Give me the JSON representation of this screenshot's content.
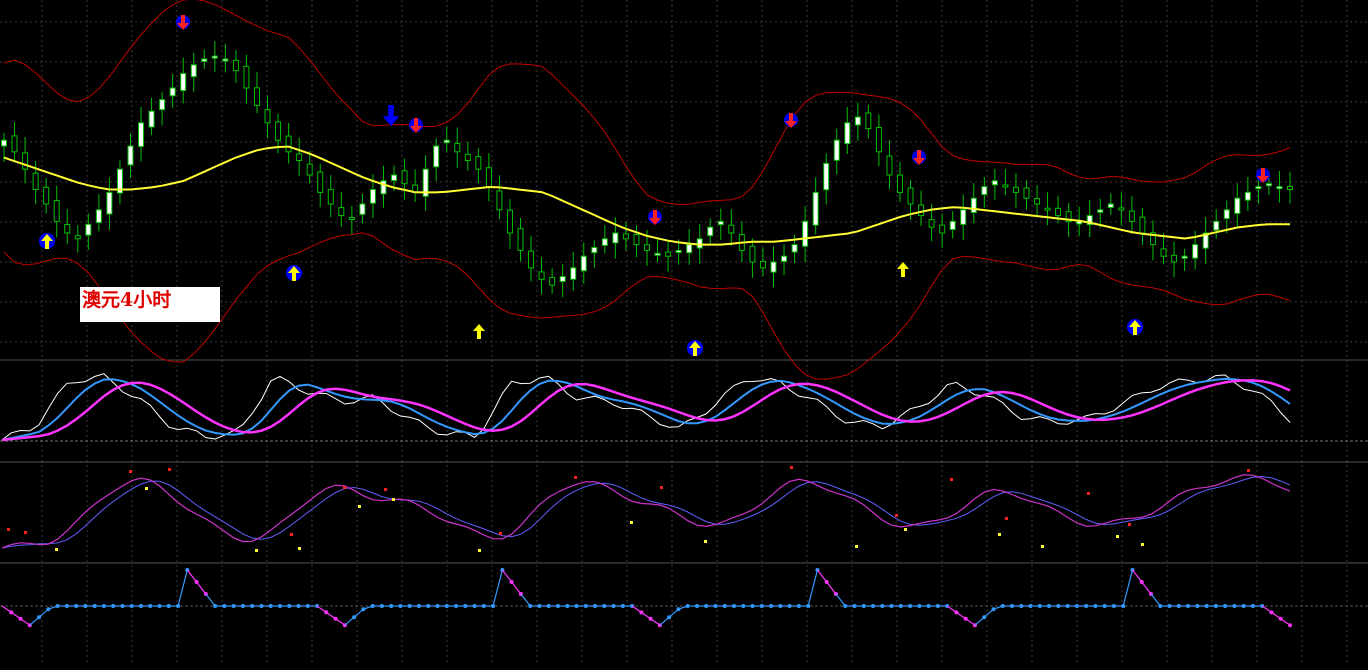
{
  "colors": {
    "background": "#000000",
    "grid": "#3a3a3a",
    "bull_candle": "#ffffff",
    "candle_edge": "#00c000",
    "bollinger": "#c00000",
    "ma": "#ffff33",
    "buy_arrow": "#ffff00",
    "sell_arrow": "#ff2020",
    "big_arrow": "#0000ff",
    "osc1_fast": "#ffffff",
    "osc1_mid": "#3399ff",
    "osc1_slow": "#ff33ff",
    "osc2_main": "#cc33cc",
    "osc2_signal": "#6060ff",
    "osc3_up": "#3399ff",
    "osc3_down": "#ff33ff"
  },
  "chart_label": "澳元4小时",
  "price_panel": {
    "type": "candlestick",
    "closes": [
      0.62,
      0.58,
      0.52,
      0.45,
      0.4,
      0.34,
      0.3,
      0.28,
      0.33,
      0.38,
      0.44,
      0.52,
      0.6,
      0.68,
      0.72,
      0.76,
      0.8,
      0.85,
      0.88,
      0.9,
      0.91,
      0.9,
      0.86,
      0.8,
      0.74,
      0.68,
      0.62,
      0.58,
      0.55,
      0.5,
      0.44,
      0.4,
      0.36,
      0.35,
      0.4,
      0.45,
      0.48,
      0.5,
      0.47,
      0.44,
      0.52,
      0.6,
      0.62,
      0.58,
      0.55,
      0.52,
      0.46,
      0.38,
      0.3,
      0.24,
      0.18,
      0.14,
      0.12,
      0.15,
      0.18,
      0.22,
      0.25,
      0.28,
      0.3,
      0.28,
      0.26,
      0.24,
      0.23,
      0.22,
      0.24,
      0.26,
      0.28,
      0.32,
      0.34,
      0.3,
      0.24,
      0.2,
      0.18,
      0.2,
      0.22,
      0.26,
      0.34,
      0.44,
      0.54,
      0.62,
      0.68,
      0.7,
      0.66,
      0.58,
      0.5,
      0.44,
      0.4,
      0.36,
      0.32,
      0.3,
      0.34,
      0.38,
      0.42,
      0.46,
      0.48,
      0.46,
      0.44,
      0.42,
      0.4,
      0.38,
      0.36,
      0.34,
      0.34,
      0.36,
      0.38,
      0.4,
      0.38,
      0.34,
      0.3,
      0.26,
      0.22,
      0.2,
      0.22,
      0.26,
      0.3,
      0.34,
      0.38,
      0.42,
      0.44,
      0.46,
      0.47,
      0.46,
      0.45
    ],
    "ma": [
      0.56,
      0.53,
      0.5,
      0.47,
      0.45,
      0.45,
      0.46,
      0.48,
      0.52,
      0.56,
      0.59,
      0.6,
      0.57,
      0.53,
      0.49,
      0.46,
      0.44,
      0.44,
      0.45,
      0.46,
      0.45,
      0.44,
      0.4,
      0.36,
      0.32,
      0.29,
      0.27,
      0.26,
      0.26,
      0.27,
      0.27,
      0.28,
      0.29,
      0.3,
      0.33,
      0.36,
      0.38,
      0.39,
      0.38,
      0.37,
      0.36,
      0.35,
      0.34,
      0.32,
      0.3,
      0.29,
      0.28,
      0.3,
      0.32,
      0.33,
      0.33
    ]
  },
  "oscillator_1": {
    "label": "",
    "series_names": [
      "",
      "",
      ""
    ]
  },
  "oscillator_2": {
    "label": ""
  },
  "oscillator_3": {
    "label": ""
  }
}
